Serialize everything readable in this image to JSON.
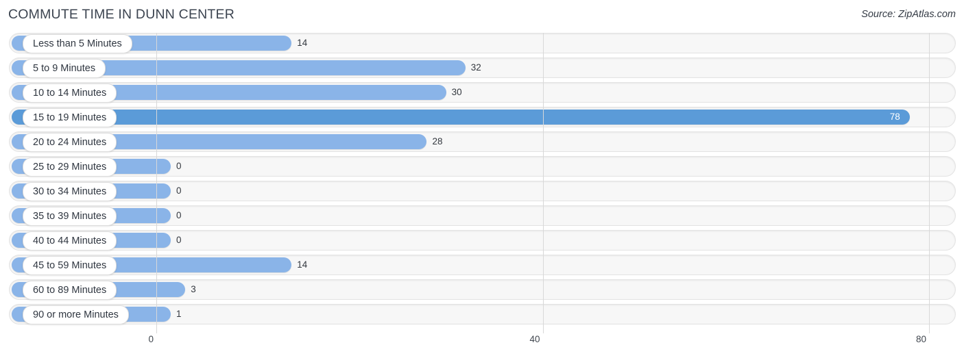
{
  "header": {
    "title": "COMMUTE TIME IN DUNN CENTER",
    "source": "Source: ZipAtlas.com"
  },
  "colors": {
    "bar": "#8ab4e8",
    "bar_highlight": "#5b9bd8",
    "track": "#f7f7f7",
    "gridline": "#d8d8d8",
    "title_text": "#3c4450"
  },
  "axis": {
    "ticks": [
      "0",
      "40",
      "80"
    ],
    "tick_values": [
      0,
      40,
      80
    ],
    "min": 0,
    "max": 80
  },
  "chart_data": {
    "type": "bar",
    "orientation": "horizontal",
    "title": "COMMUTE TIME IN DUNN CENTER",
    "subtitle": "",
    "xlabel": "",
    "ylabel": "",
    "xlim": [
      0,
      80
    ],
    "grid": true,
    "legend": null,
    "source": "Source: ZipAtlas.com",
    "highlight_category": "15 to 19 Minutes",
    "categories": [
      "Less than 5 Minutes",
      "5 to 9 Minutes",
      "10 to 14 Minutes",
      "15 to 19 Minutes",
      "20 to 24 Minutes",
      "25 to 29 Minutes",
      "30 to 34 Minutes",
      "35 to 39 Minutes",
      "40 to 44 Minutes",
      "45 to 59 Minutes",
      "60 to 89 Minutes",
      "90 or more Minutes"
    ],
    "values": [
      14,
      32,
      30,
      78,
      28,
      0,
      0,
      0,
      0,
      14,
      3,
      1
    ],
    "value_labels": [
      "14",
      "32",
      "30",
      "78",
      "28",
      "0",
      "0",
      "0",
      "0",
      "14",
      "3",
      "1"
    ]
  },
  "rows": [
    {
      "label": "Less than 5 Minutes",
      "value": 14,
      "value_label": "14",
      "highlight": false
    },
    {
      "label": "5 to 9 Minutes",
      "value": 32,
      "value_label": "32",
      "highlight": false
    },
    {
      "label": "10 to 14 Minutes",
      "value": 30,
      "value_label": "30",
      "highlight": false
    },
    {
      "label": "15 to 19 Minutes",
      "value": 78,
      "value_label": "78",
      "highlight": true
    },
    {
      "label": "20 to 24 Minutes",
      "value": 28,
      "value_label": "28",
      "highlight": false
    },
    {
      "label": "25 to 29 Minutes",
      "value": 0,
      "value_label": "0",
      "highlight": false
    },
    {
      "label": "30 to 34 Minutes",
      "value": 0,
      "value_label": "0",
      "highlight": false
    },
    {
      "label": "35 to 39 Minutes",
      "value": 0,
      "value_label": "0",
      "highlight": false
    },
    {
      "label": "40 to 44 Minutes",
      "value": 0,
      "value_label": "0",
      "highlight": false
    },
    {
      "label": "45 to 59 Minutes",
      "value": 14,
      "value_label": "14",
      "highlight": false
    },
    {
      "label": "60 to 89 Minutes",
      "value": 3,
      "value_label": "3",
      "highlight": false
    },
    {
      "label": "90 or more Minutes",
      "value": 1,
      "value_label": "1",
      "highlight": false
    }
  ]
}
